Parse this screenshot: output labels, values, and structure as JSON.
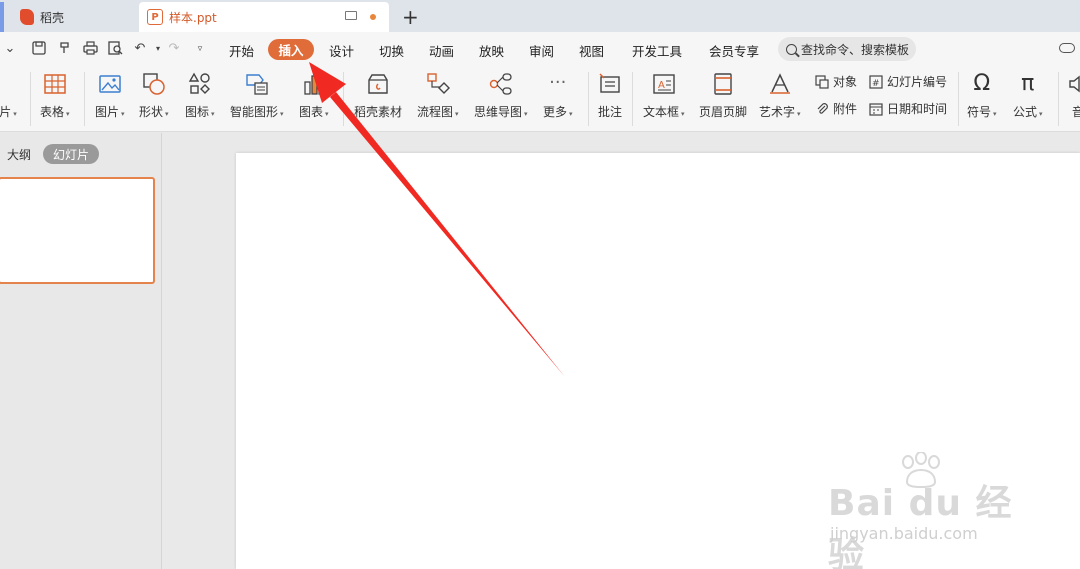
{
  "tabs": {
    "docer_label": "稻壳",
    "doc_label": "样本.ppt",
    "add_symbol": "+"
  },
  "menu": {
    "items": [
      "开始",
      "插入",
      "设计",
      "切换",
      "动画",
      "放映",
      "审阅",
      "视图",
      "开发工具",
      "会员专享"
    ],
    "active": "插入",
    "search_label": "查找命令、搜索模板"
  },
  "ribbon": {
    "partial_left": "片",
    "table": "表格",
    "picture": "图片",
    "shape": "形状",
    "icon": "图标",
    "smart_graphic": "智能图形",
    "chart": "图表",
    "docer_assets": "稻壳素材",
    "flowchart": "流程图",
    "mindmap": "思维导图",
    "more": "更多",
    "comment": "批注",
    "textbox": "文本框",
    "header_footer": "页眉页脚",
    "wordart": "艺术字",
    "object": "对象",
    "attachment": "附件",
    "slide_number": "幻灯片编号",
    "datetime": "日期和时间",
    "symbol": "符号",
    "formula": "公式",
    "partial_right": "音"
  },
  "left_panel": {
    "outline_tab": "大纲",
    "slides_tab": "幻灯片"
  },
  "watermark": {
    "logo": "Bai du 经验",
    "url": "jingyan.baidu.com"
  },
  "colors": {
    "accent": "#e06c3a",
    "arrow": "#f02a22",
    "thumb_border": "#e5834c"
  }
}
